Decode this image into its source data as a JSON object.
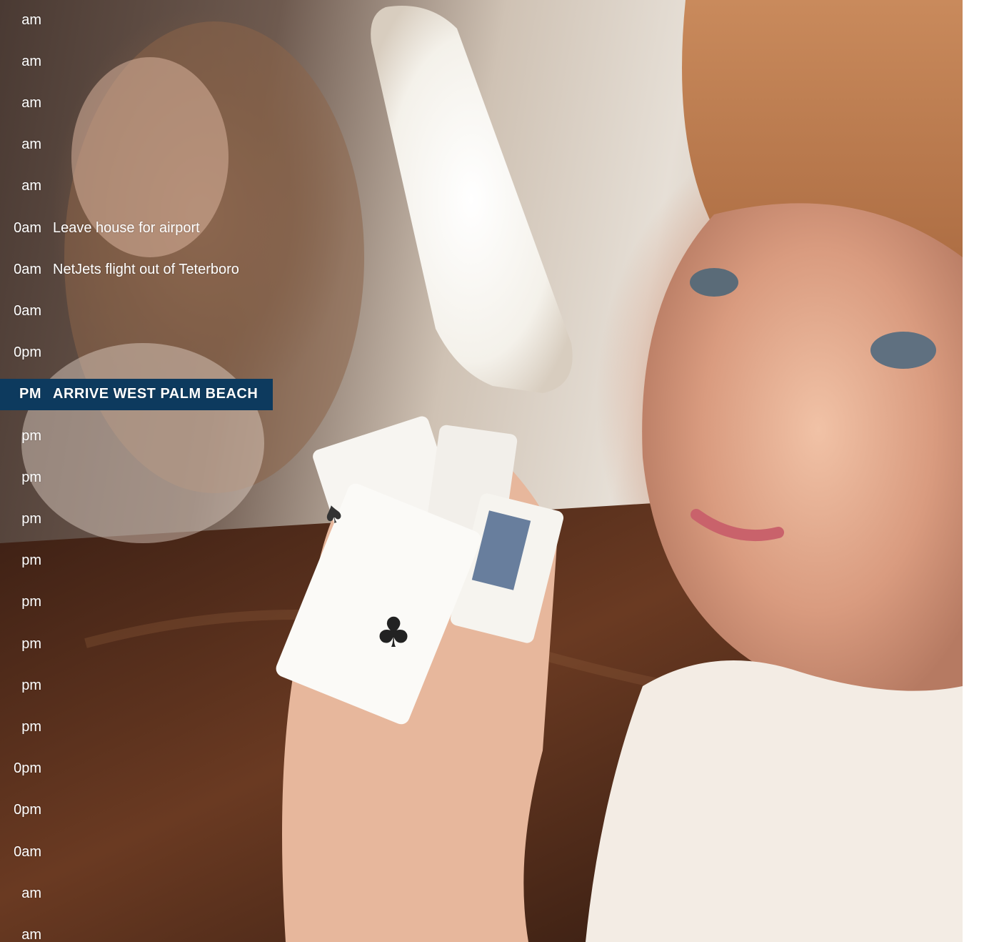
{
  "schedule": [
    {
      "time": "am",
      "event": ""
    },
    {
      "time": "am",
      "event": ""
    },
    {
      "time": "am",
      "event": ""
    },
    {
      "time": "am",
      "event": ""
    },
    {
      "time": "am",
      "event": ""
    },
    {
      "time": "0am",
      "event": "Leave house for airport"
    },
    {
      "time": "0am",
      "event": "NetJets flight out of Teterboro"
    },
    {
      "time": "0am",
      "event": ""
    },
    {
      "time": "0pm",
      "event": ""
    },
    {
      "time": "PM",
      "event": "ARRIVE WEST PALM BEACH",
      "highlight": true
    },
    {
      "time": "pm",
      "event": ""
    },
    {
      "time": "pm",
      "event": ""
    },
    {
      "time": "pm",
      "event": ""
    },
    {
      "time": "pm",
      "event": ""
    },
    {
      "time": "pm",
      "event": ""
    },
    {
      "time": "pm",
      "event": ""
    },
    {
      "time": "pm",
      "event": ""
    },
    {
      "time": "pm",
      "event": ""
    },
    {
      "time": "0pm",
      "event": ""
    },
    {
      "time": "0pm",
      "event": ""
    },
    {
      "time": "0am",
      "event": ""
    },
    {
      "time": "am",
      "event": ""
    },
    {
      "time": "am",
      "event": ""
    }
  ],
  "colors": {
    "highlight_bar": "#0d3a5e",
    "text": "#ffffff"
  }
}
